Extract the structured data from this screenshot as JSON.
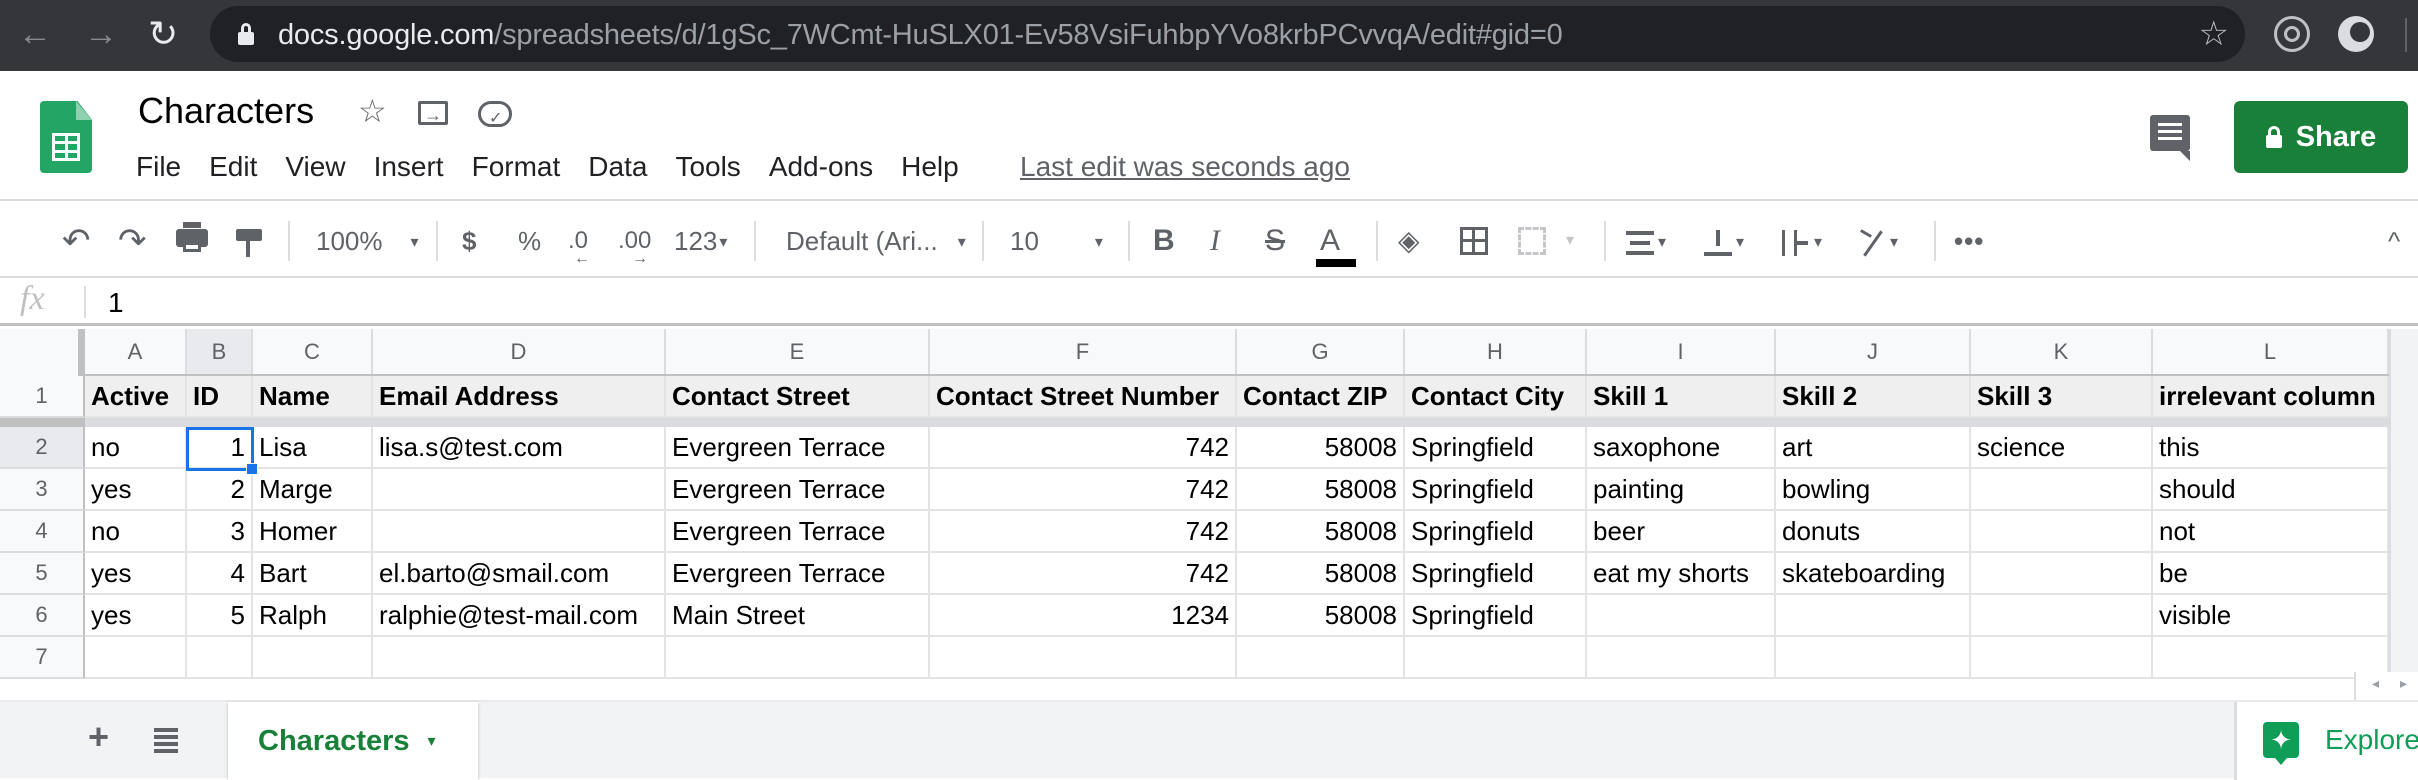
{
  "browser": {
    "url_host": "docs.google.com",
    "url_path": "/spreadsheets/d/1gSc_7WCmt-HuSLX01-Ev58VsiFuhbpYVo8krbPCvvqA/edit#gid=0",
    "back_glyph": "←",
    "forward_glyph": "→",
    "reload_glyph": "↻",
    "bookmark_glyph": "☆"
  },
  "header": {
    "doc_title": "Characters",
    "star_glyph": "☆",
    "menu": [
      "File",
      "Edit",
      "View",
      "Insert",
      "Format",
      "Data",
      "Tools",
      "Add-ons",
      "Help"
    ],
    "last_edit": "Last edit was seconds ago",
    "share_label": "Share",
    "brand_color": "#188038"
  },
  "toolbar": {
    "undo_glyph": "↶",
    "redo_glyph": "↷",
    "zoom": "100%",
    "currency": "$",
    "percent": "%",
    "decrease_decimal": ".0",
    "increase_decimal": ".00",
    "more_formats": "123",
    "font": "Default (Ari...",
    "font_size": "10",
    "bold": "B",
    "italic": "I",
    "strikethrough": "S",
    "text_color": "A",
    "text_color_value": "#000000",
    "fill_glyph": "◈",
    "more": "•••",
    "caret": "▾",
    "collapse_glyph": "^"
  },
  "formula_bar": {
    "fx_label": "fx",
    "value": "1"
  },
  "grid": {
    "selected_cell": "B2",
    "columns": [
      "A",
      "B",
      "C",
      "D",
      "E",
      "F",
      "G",
      "H",
      "I",
      "J",
      "K",
      "L"
    ],
    "row_numbers": [
      "1",
      "2",
      "3",
      "4",
      "5",
      "6",
      "7"
    ],
    "header_row": [
      "Active",
      "ID",
      "Name",
      "Email Address",
      "Contact Street",
      "Contact Street Number",
      "Contact ZIP",
      "Contact City",
      "Skill 1",
      "Skill 2",
      "Skill 3",
      "irrelevant column"
    ],
    "rows": [
      [
        "no",
        "1",
        "Lisa",
        "lisa.s@test.com",
        "Evergreen Terrace",
        "742",
        "58008",
        "Springfield",
        "saxophone",
        "art",
        "science",
        "this"
      ],
      [
        "yes",
        "2",
        "Marge",
        "",
        "Evergreen Terrace",
        "742",
        "58008",
        "Springfield",
        "painting",
        "bowling",
        "",
        "should"
      ],
      [
        "no",
        "3",
        "Homer",
        "",
        "Evergreen Terrace",
        "742",
        "58008",
        "Springfield",
        "beer",
        "donuts",
        "",
        "not"
      ],
      [
        "yes",
        "4",
        "Bart",
        "el.barto@smail.com",
        "Evergreen Terrace",
        "742",
        "58008",
        "Springfield",
        "eat my shorts",
        "skateboarding",
        "",
        "be"
      ],
      [
        "yes",
        "5",
        "Ralph",
        "ralphie@test-mail.com",
        "Main Street",
        "1234",
        "58008",
        "Springfield",
        "",
        "",
        "",
        "visible"
      ],
      [
        "",
        "",
        "",
        "",
        "",
        "",
        "",
        "",
        "",
        "",
        "",
        ""
      ]
    ],
    "numeric_columns": [
      1,
      5,
      6
    ]
  },
  "bottom": {
    "add_sheet_glyph": "+",
    "sheet_tabs": [
      "Characters"
    ],
    "active_sheet": "Characters",
    "explore_label": "Explore",
    "explore_glyph": "✦",
    "scroll_left_glyph": "◂",
    "scroll_right_glyph": "▸"
  }
}
